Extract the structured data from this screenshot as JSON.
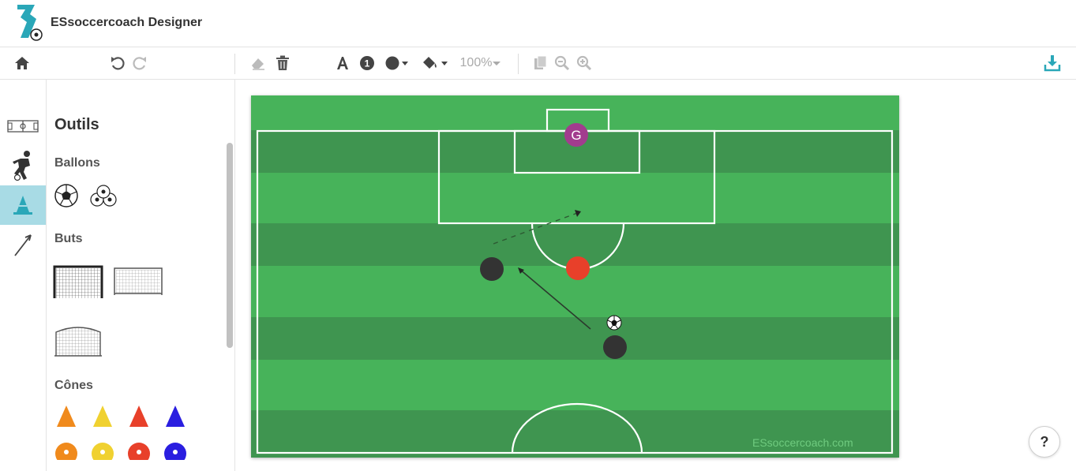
{
  "app": {
    "title": "ESsoccercoach Designer"
  },
  "toolbar": {
    "zoom": "100%",
    "icons": [
      "home-icon",
      "undo-icon",
      "redo-icon",
      "eraser-icon",
      "trash-icon",
      "text-icon",
      "number-icon",
      "shape-color-icon",
      "fill-color-icon",
      "zoom-dropdown",
      "copy-icon",
      "zoom-out-icon",
      "zoom-in-icon",
      "download-icon"
    ]
  },
  "rail": {
    "items": [
      "pitch-icon",
      "player-icon",
      "cone-icon",
      "arrow-icon"
    ],
    "active": "cone-icon"
  },
  "panel": {
    "title": "Outils",
    "sections": {
      "balls": "Ballons",
      "goals": "Buts",
      "cones": "Cônes"
    },
    "cone_colors": [
      "#f08a1c",
      "#f0d130",
      "#e8402a",
      "#2a1ee0"
    ]
  },
  "pitch": {
    "grass_light": "#47b35a",
    "grass_dark": "#3f9550",
    "goalkeeper_label": "G",
    "goalkeeper_color": "#a23c8e",
    "player_dark_color": "#333333",
    "player_red_color": "#e8402a",
    "watermark": "ESsoccercoach.com"
  },
  "help": {
    "label": "?"
  }
}
